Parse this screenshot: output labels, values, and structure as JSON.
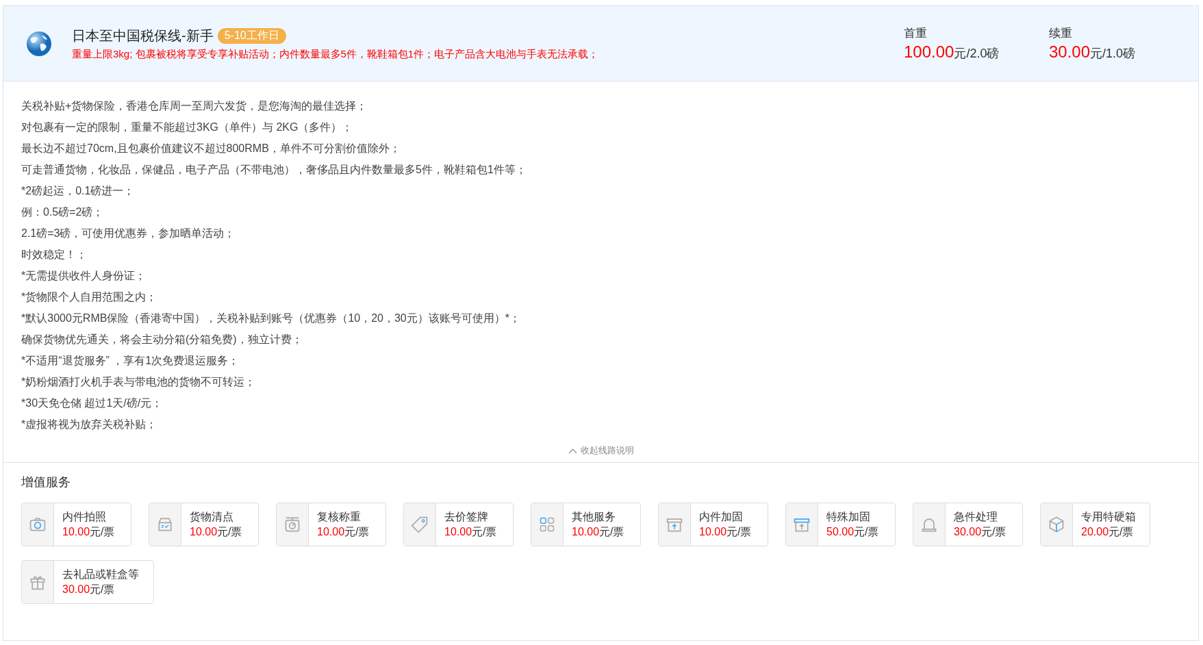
{
  "route": {
    "title": "日本至中国税保线-新手",
    "badge": "5-10工作日",
    "notice": "重量上限3kg; 包裹被税将享受专享补贴活动；内件数量最多5件，靴鞋箱包1件；电子产品含大电池与手表无法承载；",
    "prices": [
      {
        "label": "首重",
        "amount": "100.00",
        "unit": "元/2.0磅"
      },
      {
        "label": "续重",
        "amount": "30.00",
        "unit": "元/1.0磅"
      }
    ]
  },
  "description": [
    "关税补贴+货物保险，香港仓库周一至周六发货，是您海淘的最佳选择；",
    "对包裹有一定的限制，重量不能超过3KG（单件）与 2KG（多件）；",
    "最长边不超过70cm,且包裹价值建议不超过800RMB，单件不可分割价值除外；",
    "可走普通货物，化妆品，保健品，电子产品（不带电池），奢侈品且内件数量最多5件，靴鞋箱包1件等；",
    "*2磅起运，0.1磅进一；",
    "例：0.5磅=2磅；",
    "2.1磅=3磅，可使用优惠券，参加晒单活动；",
    "时效稳定！；",
    "*无需提供收件人身份证；",
    "*货物限个人自用范围之内；",
    "*默认3000元RMB保险（香港寄中国），关税补贴到账号（优惠券（10，20，30元）该账号可使用）*；",
    "确保货物优先通关，将会主动分箱(分箱免费)，独立计费；",
    "*不适用“退货服务” ，享有1次免费退运服务；",
    "*奶粉烟酒打火机手表与带电池的货物不可转运；",
    "*30天免仓储 超过1天/磅/元；",
    "*虚报将视为放弃关税补贴；"
  ],
  "collapse_link": "收起线路说明",
  "services_title": "增值服务",
  "services": [
    {
      "kind": "camera",
      "name": "内件拍照",
      "amount": "10.00",
      "unit": "元/票"
    },
    {
      "kind": "tray",
      "name": "货物清点",
      "amount": "10.00",
      "unit": "元/票"
    },
    {
      "kind": "scale",
      "name": "复核称重",
      "amount": "10.00",
      "unit": "元/票"
    },
    {
      "kind": "tag",
      "name": "去价签牌",
      "amount": "10.00",
      "unit": "元/票"
    },
    {
      "kind": "grid",
      "name": "其他服务",
      "amount": "10.00",
      "unit": "元/票"
    },
    {
      "kind": "box",
      "name": "内件加固",
      "amount": "10.00",
      "unit": "元/票"
    },
    {
      "kind": "box-lid",
      "name": "特殊加固",
      "amount": "50.00",
      "unit": "元/票"
    },
    {
      "kind": "bell",
      "name": "急件处理",
      "amount": "30.00",
      "unit": "元/票"
    },
    {
      "kind": "cube",
      "name": "专用特硬箱",
      "amount": "20.00",
      "unit": "元/票"
    },
    {
      "kind": "gift",
      "name": "去礼品或鞋盒等",
      "amount": "30.00",
      "unit": "元/票"
    }
  ]
}
